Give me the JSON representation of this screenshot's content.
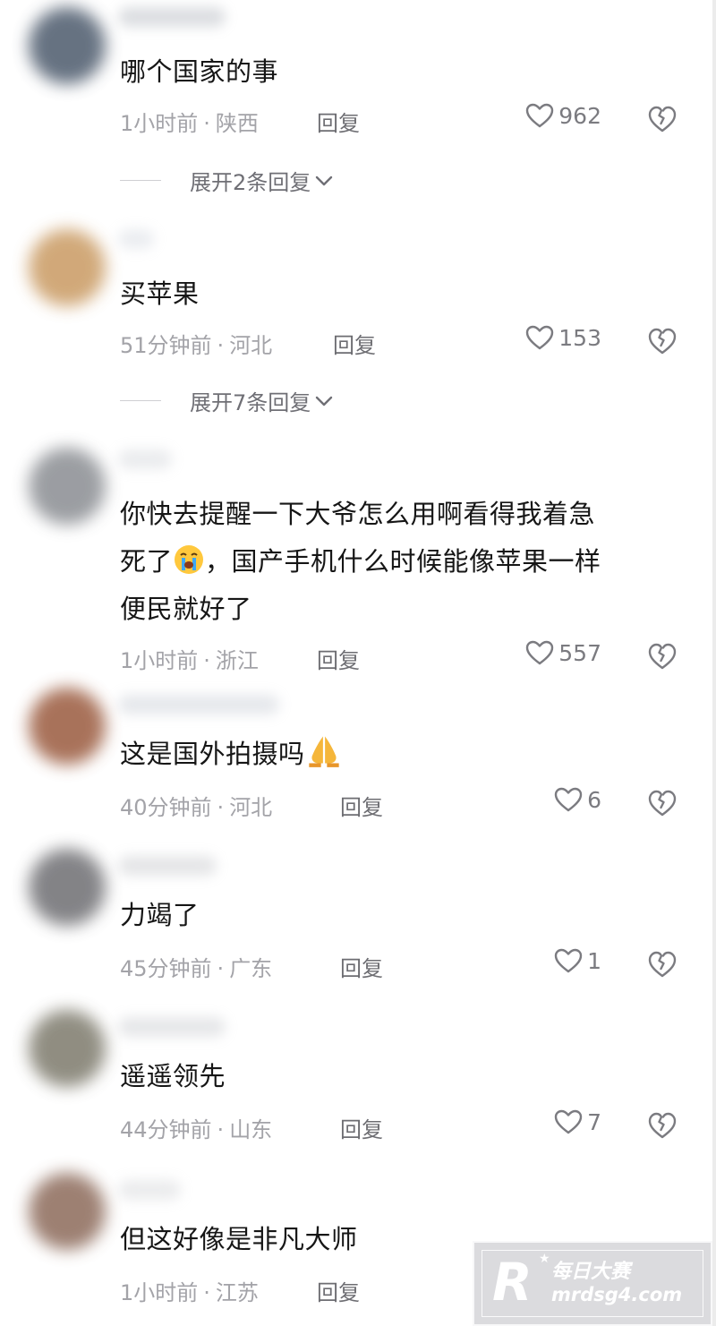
{
  "reply_label": "回复",
  "comments": [
    {
      "text": "哪个国家的事",
      "time": "1小时前",
      "location": "陕西",
      "likes": "962",
      "expand": "展开2条回复"
    },
    {
      "text": "买苹果",
      "time": "51分钟前",
      "location": "河北",
      "likes": "153",
      "expand": "展开7条回复"
    },
    {
      "text_line1": "你快去提醒一下大爷怎么用啊看得我着急",
      "text_line2a": "死了",
      "text_line2b": "，国产手机什么时候能像苹果一样",
      "text_line3": "便民就好了",
      "emoji": "crying-face",
      "time": "1小时前",
      "location": "浙江",
      "likes": "557"
    },
    {
      "text": "这是国外拍摄吗",
      "emoji": "folded-hands",
      "time": "40分钟前",
      "location": "河北",
      "likes": "6"
    },
    {
      "text": "力竭了",
      "time": "45分钟前",
      "location": "广东",
      "likes": "1"
    },
    {
      "text": "遥遥领先",
      "time": "44分钟前",
      "location": "山东",
      "likes": "7"
    },
    {
      "text": "但这好像是非凡大师",
      "time": "1小时前",
      "location": "江苏"
    }
  ],
  "watermark": {
    "logo": "R",
    "title": "每日大赛",
    "url": "mrdsg4.com"
  },
  "colors": {
    "meta": "#a3a3a8",
    "text": "#161616",
    "icon": "#7b7b80"
  }
}
